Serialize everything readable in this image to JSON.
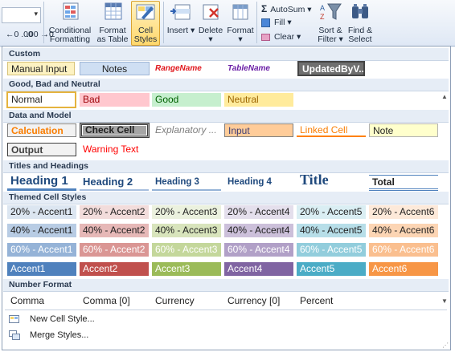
{
  "ribbon": {
    "decimal_inc": "←0 .00",
    "decimal_dec": ".00 →0",
    "conditional_formatting": [
      "Conditional",
      "Formatting ▾"
    ],
    "format_as_table": [
      "Format",
      "as Table ▾"
    ],
    "cell_styles": [
      "Cell",
      "Styles ▾"
    ],
    "insert": "Insert ▾",
    "delete": "Delete ▾",
    "format": "Format ▾",
    "autosum": "AutoSum ▾",
    "fill": "Fill ▾",
    "clear": "Clear ▾",
    "sort_filter": [
      "Sort &",
      "Filter ▾"
    ],
    "find_select": [
      "Find &",
      "Select ▾"
    ]
  },
  "sections": {
    "custom": "Custom",
    "good_bad": "Good, Bad and Neutral",
    "data_model": "Data and Model",
    "titles": "Titles and Headings",
    "themed": "Themed Cell Styles",
    "number_format": "Number Format"
  },
  "custom_styles": [
    "Manual Input",
    "Notes",
    "RangeName",
    "TableName",
    "UpdatedByV..."
  ],
  "good_bad_styles": [
    "Normal",
    "Bad",
    "Good",
    "Neutral"
  ],
  "data_model_styles": [
    "Calculation",
    "Check Cell",
    "Explanatory ...",
    "Input",
    "Linked Cell",
    "Note",
    "Output",
    "Warning Text"
  ],
  "title_styles": [
    "Heading 1",
    "Heading 2",
    "Heading 3",
    "Heading 4",
    "Title",
    "Total"
  ],
  "themed_styles": {
    "row20": [
      "20% - Accent1",
      "20% - Accent2",
      "20% - Accent3",
      "20% - Accent4",
      "20% - Accent5",
      "20% - Accent6"
    ],
    "row40": [
      "40% - Accent1",
      "40% - Accent2",
      "40% - Accent3",
      "40% - Accent4",
      "40% - Accent5",
      "40% - Accent6"
    ],
    "row60": [
      "60% - Accent1",
      "60% - Accent2",
      "60% - Accent3",
      "60% - Accent4",
      "60% - Accent5",
      "60% - Accent6"
    ],
    "accent": [
      "Accent1",
      "Accent2",
      "Accent3",
      "Accent4",
      "Accent5",
      "Accent6"
    ]
  },
  "number_styles": [
    "Comma",
    "Comma [0]",
    "Currency",
    "Currency [0]",
    "Percent"
  ],
  "menu": {
    "new_cell_style": "New Cell Style...",
    "merge_styles": "Merge Styles..."
  },
  "colors": {
    "accent1": "#4f81bd",
    "accent2": "#c0504d",
    "accent3": "#9bbb59",
    "accent4": "#8064a2",
    "accent5": "#4bacc6",
    "accent6": "#f79646"
  }
}
